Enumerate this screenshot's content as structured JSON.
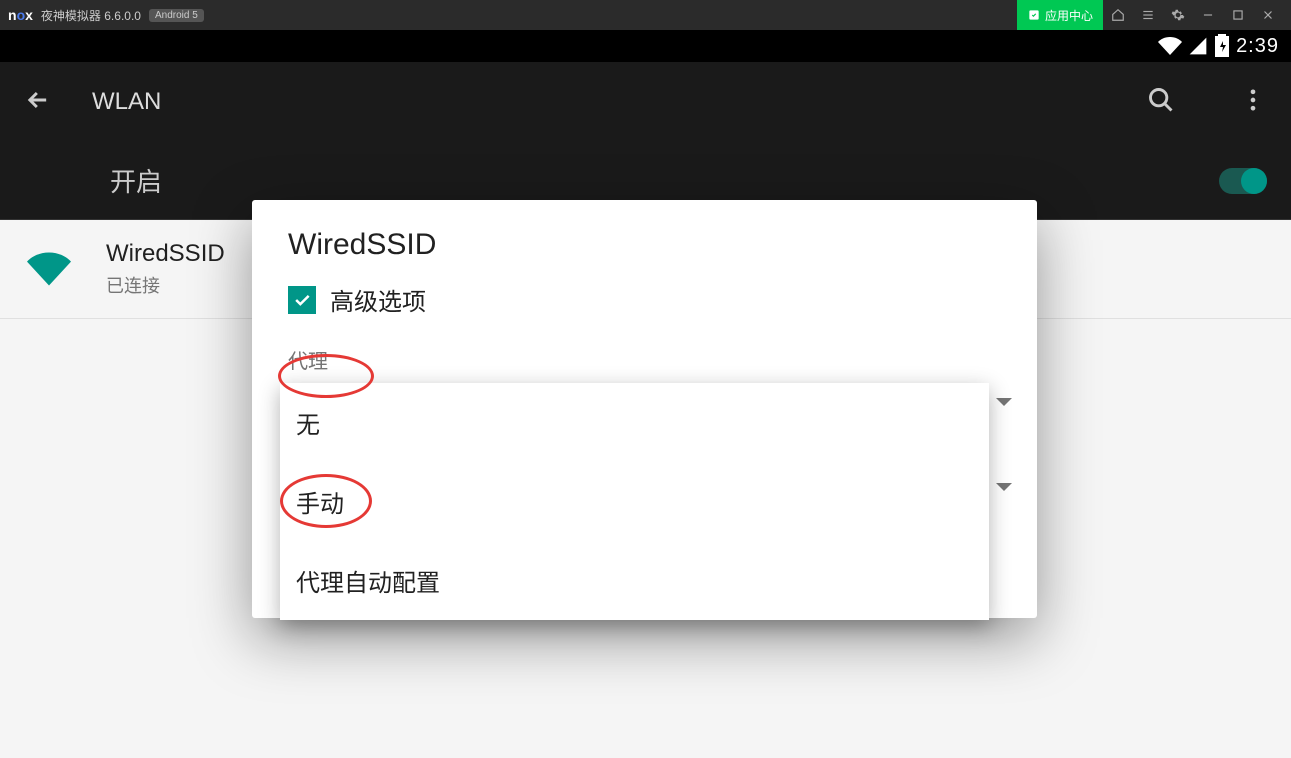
{
  "nox": {
    "title": "夜神模拟器 6.6.0.0",
    "android_badge": "Android 5",
    "app_center": "应用中心"
  },
  "android_status": {
    "time": "2:39"
  },
  "wlan": {
    "title": "WLAN",
    "toggle_label": "开启",
    "networks": [
      {
        "name": "WiredSSID",
        "status": "已连接"
      }
    ]
  },
  "dialog": {
    "title": "WiredSSID",
    "advanced_label": "高级选项",
    "field_proxy_label": "代理"
  },
  "proxy_dropdown": {
    "options": [
      "无",
      "手动",
      "代理自动配置"
    ]
  }
}
